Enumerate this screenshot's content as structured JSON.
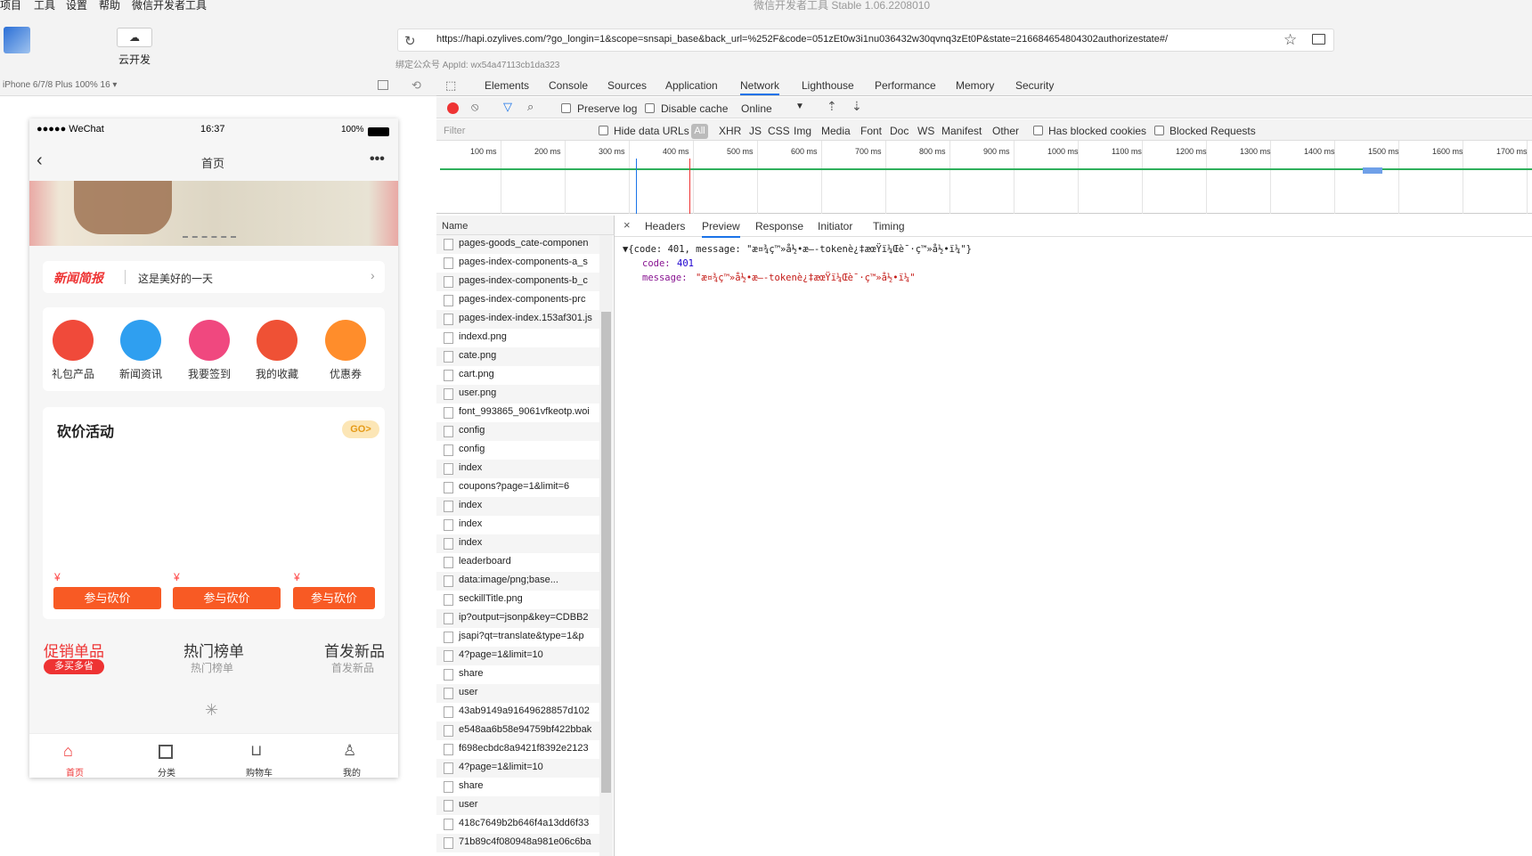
{
  "menu": [
    "项目",
    "工具",
    "设置",
    "帮助",
    "微信开发者工具"
  ],
  "window_title": "微信开发者工具 Stable 1.06.2208010",
  "toolbar": {
    "cloud_label": "云开发",
    "cloud_icon": "cloud-icon"
  },
  "url": "https://hapi.ozylives.com/?go_longin=1&scope=snsapi_base&back_url=%252F&code=051zEt0w3i1nu036432w30qvnq3zEt0P&state=216684654804302authorizestate#/",
  "appid": "绑定公众号 AppId: wx54a47113cb1da323",
  "device_label": "iPhone 6/7/8 Plus 100% 16 ▾",
  "phone": {
    "status_left": "●●●●● WeChat",
    "status_time": "16:37",
    "status_battery": "100%",
    "nav_title": "首页",
    "nav_more": "•••",
    "news_brand": "新闻简报",
    "news_text": "这是美好的一天",
    "icons": [
      {
        "label": "礼包产品",
        "color": "#f04a3a"
      },
      {
        "label": "新闻资讯",
        "color": "#2f9ff0"
      },
      {
        "label": "我要签到",
        "color": "#f0487f"
      },
      {
        "label": "我的收藏",
        "color": "#ef5135"
      },
      {
        "label": "优惠券",
        "color": "#ff8d2b"
      }
    ],
    "kanjia_title": "砍价活动",
    "kanjia_go": "GO>",
    "yen": "¥",
    "kanjia_button": "参与砍价",
    "tabs": [
      {
        "title": "促销单品",
        "sub": "多买多省"
      },
      {
        "title": "热门榜单",
        "sub": "热门榜单"
      },
      {
        "title": "首发新品",
        "sub": "首发新品"
      }
    ],
    "tabbar": [
      "首页",
      "分类",
      "购物车",
      "我的"
    ]
  },
  "devtools": {
    "tabs": [
      "Elements",
      "Console",
      "Sources",
      "Application",
      "Network",
      "Lighthouse",
      "Performance",
      "Memory",
      "Security"
    ],
    "preserve_log": "Preserve log",
    "disable_cache": "Disable cache",
    "throttle": "Online",
    "filter_placeholder": "Filter",
    "hide_data_urls": "Hide data URLs",
    "types": [
      "All",
      "XHR",
      "JS",
      "CSS",
      "Img",
      "Media",
      "Font",
      "Doc",
      "WS",
      "Manifest",
      "Other"
    ],
    "has_blocked": "Has blocked cookies",
    "blocked_requests": "Blocked Requests",
    "timeline_ticks": [
      "100 ms",
      "200 ms",
      "300 ms",
      "400 ms",
      "500 ms",
      "600 ms",
      "700 ms",
      "800 ms",
      "900 ms",
      "1000 ms",
      "1100 ms",
      "1200 ms",
      "1300 ms",
      "1400 ms",
      "1500 ms",
      "1600 ms",
      "1700 ms"
    ],
    "name_header": "Name",
    "requests": [
      "pages-goods_cate-componen",
      "pages-index-components-a_s",
      "pages-index-components-b_c",
      "pages-index-components-prc",
      "pages-index-index.153af301.js",
      "indexd.png",
      "cate.png",
      "cart.png",
      "user.png",
      "font_993865_9061vfkeotp.woi",
      "config",
      "config",
      "index",
      "coupons?page=1&limit=6",
      "index",
      "index",
      "index",
      "leaderboard",
      "data:image/png;base...",
      "seckillTitle.png",
      "ip?output=jsonp&key=CDBB2",
      "jsapi?qt=translate&type=1&p",
      "4?page=1&limit=10",
      "share",
      "user",
      "43ab9149a91649628857d102",
      "e548aa6b58e94759bf422bbak",
      "f698ecbdc8a9421f8392e2123",
      "4?page=1&limit=10",
      "share",
      "user",
      "418c7649b2b646f4a13dd6f33",
      "71b89c4f080948a981e06c6ba"
    ],
    "detail_tabs": [
      "Headers",
      "Preview",
      "Response",
      "Initiator",
      "Timing"
    ],
    "preview_line1": "▼{code: 401, message: \"æ¤¾ç™»å½•æ–-tokenè¿‡æœŸï¼Œè¯·ç™»å½•ï¼\"}",
    "preview_code_key": "code:",
    "preview_code_val": "401",
    "preview_msg_key": "message:",
    "preview_msg_val": "\"æ¤¾ç™»å½•æ–-tokenè¿‡æœŸï¼Œè¯·ç™»å½•ï¼\""
  }
}
